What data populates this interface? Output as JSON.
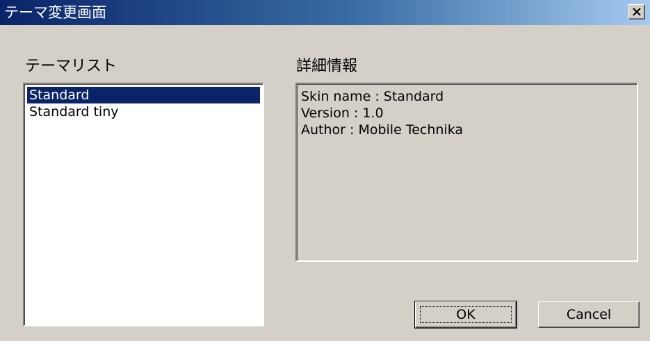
{
  "window": {
    "title": "テーマ変更画面",
    "close_glyph": "✕"
  },
  "theme_list": {
    "label": "テーマリスト",
    "items": [
      "Standard",
      "Standard tiny"
    ],
    "selected_index": 0
  },
  "details": {
    "label": "詳細情報",
    "lines": [
      "Skin name : Standard",
      "Version : 1.0",
      "Author : Mobile Technika"
    ]
  },
  "buttons": {
    "ok": "OK",
    "cancel": "Cancel"
  },
  "colors": {
    "titlebar_start": "#0a246a",
    "titlebar_end": "#a6caf0",
    "selection": "#0a246a",
    "face": "#d4d0c8"
  }
}
